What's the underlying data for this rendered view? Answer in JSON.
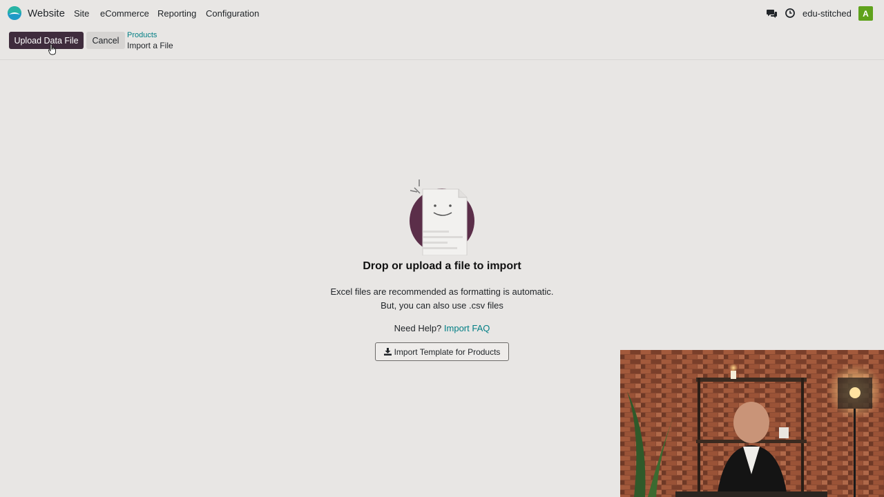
{
  "navbar": {
    "app_name": "Website",
    "menu": [
      "Site",
      "eCommerce",
      "Reporting",
      "Configuration"
    ],
    "company": "edu-stitched",
    "avatar_letter": "A"
  },
  "control_panel": {
    "upload_label": "Upload Data File",
    "cancel_label": "Cancel",
    "breadcrumb_parent": "Products",
    "breadcrumb_current": "Import a File"
  },
  "import": {
    "title": "Drop or upload a file to import",
    "line1": "Excel files are recommended as formatting is automatic.",
    "line2": "But, you can also use .csv files",
    "help_prefix": "Need Help?",
    "help_link": "Import FAQ",
    "template_button": "Import Template for Products"
  },
  "icons": {
    "app_logo": "odoo-website-logo",
    "chat": "chat-icon",
    "activity": "clock-icon",
    "download": "download-icon"
  },
  "colors": {
    "primary": "#3f2c3d",
    "link": "#017e84",
    "avatar": "#5fa21c",
    "background": "#e8e6e4"
  }
}
